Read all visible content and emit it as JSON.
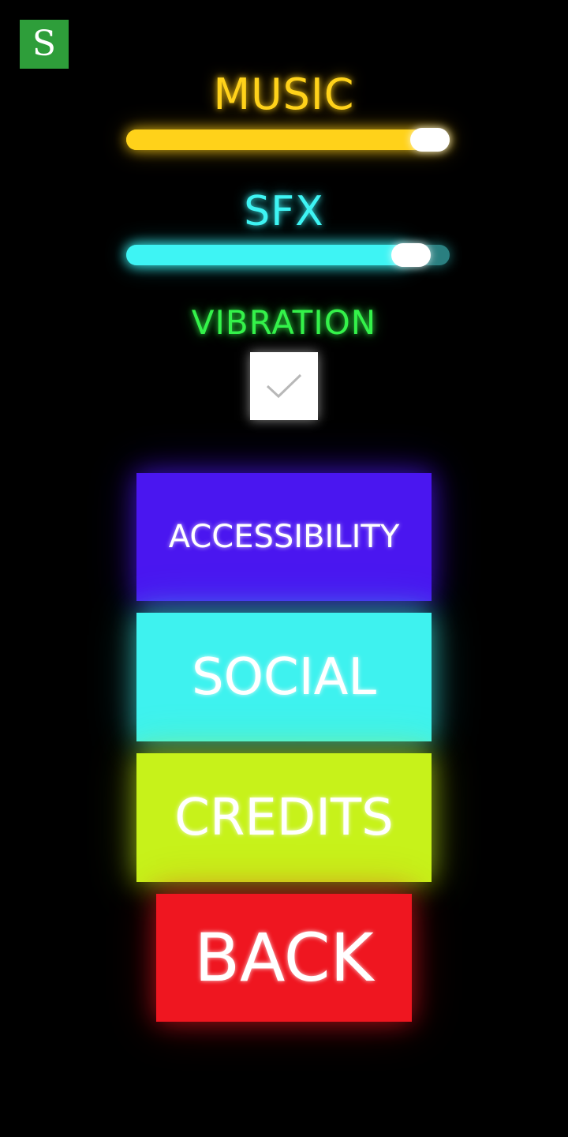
{
  "app_badge": {
    "glyph": "S",
    "color": "#2e9e3a"
  },
  "settings": {
    "music": {
      "label": "MUSIC",
      "level": 0.94,
      "color": "#ffd21a"
    },
    "sfx": {
      "label": "SFX",
      "level": 0.88,
      "color": "#3ef4f4"
    },
    "vibration": {
      "label": "VIBRATION",
      "checked": true,
      "color": "#34f24a"
    }
  },
  "menu": {
    "accessibility_label": "ACCESSIBILITY",
    "social_label": "SOCIAL",
    "credits_label": "CREDITS",
    "back_label": "BACK"
  },
  "colors": {
    "background": "#000000",
    "accessibility": "#4a16f0",
    "social": "#3ef2ef",
    "credits": "#c7f21a",
    "back": "#ef1620"
  }
}
